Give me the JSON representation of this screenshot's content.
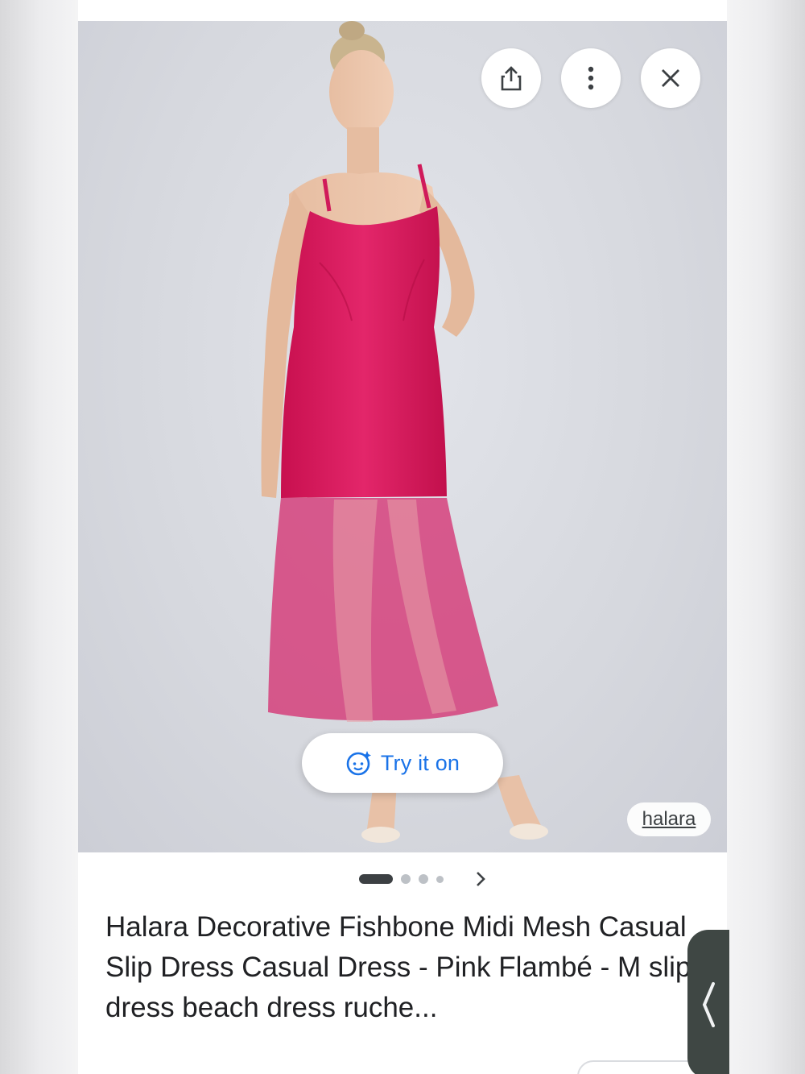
{
  "image": {
    "alt_icon": "product-photo",
    "background_color": "#d8dae0",
    "dress_color": "#d6185e"
  },
  "actions": {
    "share_icon": "share-icon",
    "more_icon": "more-vert-icon",
    "close_icon": "close-icon"
  },
  "try_on": {
    "label": "Try it on",
    "icon": "face-sparkle-icon",
    "color": "#1a73e8"
  },
  "source": {
    "label": "halara"
  },
  "carousel": {
    "total": 4,
    "active_index": 0,
    "next_icon": "chevron-right-icon"
  },
  "product": {
    "title": "Halara Decorative Fishbone Midi Mesh Casual Slip Dress Casual Dress - Pink Flambé - M slip dress beach dress ruche..."
  },
  "side_panel": {
    "icon": "chevron-left-icon"
  }
}
